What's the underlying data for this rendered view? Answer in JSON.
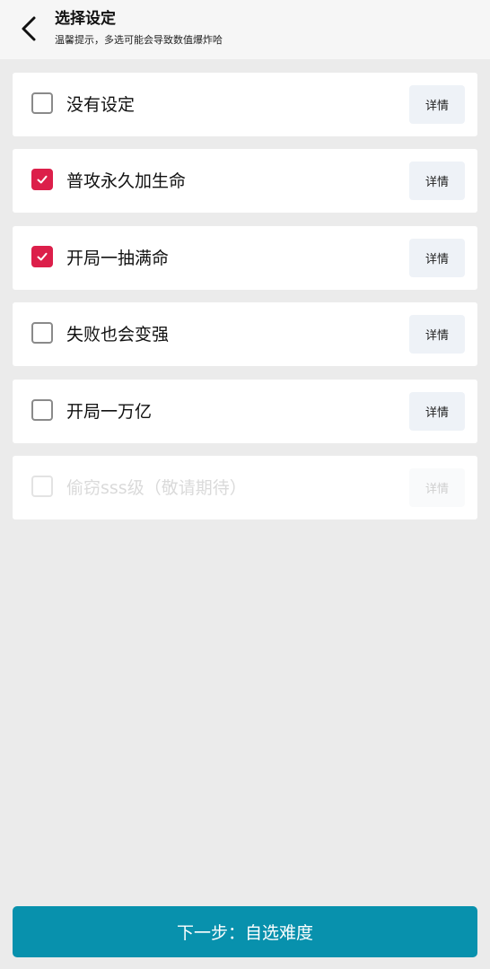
{
  "header": {
    "title": "选择设定",
    "subtitle": "温馨提示，多选可能会导致数值爆炸哈"
  },
  "options": [
    {
      "label": "没有设定",
      "details_label": "详情",
      "checked": false,
      "disabled": false
    },
    {
      "label": "普攻永久加生命",
      "details_label": "详情",
      "checked": true,
      "disabled": false
    },
    {
      "label": "开局一抽满命",
      "details_label": "详情",
      "checked": true,
      "disabled": false
    },
    {
      "label": "失败也会变强",
      "details_label": "详情",
      "checked": false,
      "disabled": false
    },
    {
      "label": "开局一万亿",
      "details_label": "详情",
      "checked": false,
      "disabled": false
    },
    {
      "label": "偷窃sss级（敬请期待）",
      "details_label": "详情",
      "checked": false,
      "disabled": true
    }
  ],
  "footer": {
    "next_label": "下一步：自选难度"
  },
  "colors": {
    "accent": "#dc1f4a",
    "primary_button": "#0891ad",
    "background": "#ebebeb"
  },
  "icons": {
    "back": "chevron-left-icon",
    "check": "checkmark-icon"
  }
}
